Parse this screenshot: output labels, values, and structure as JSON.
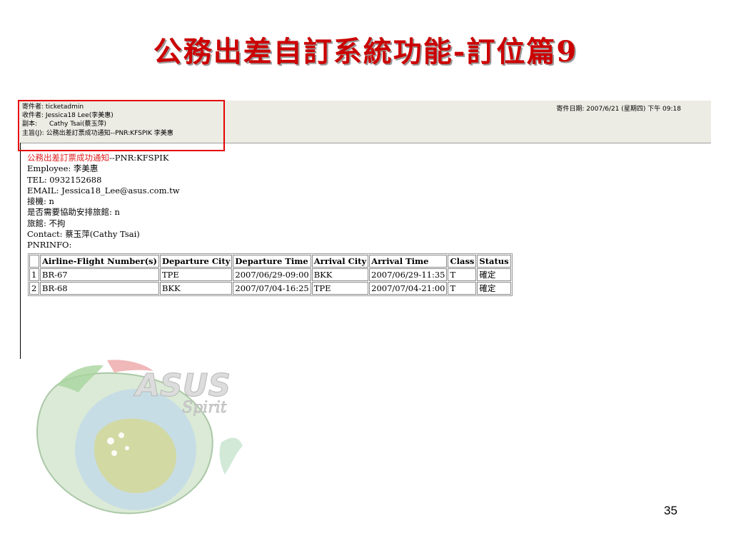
{
  "slide": {
    "title": "公務出差自訂系統功能-訂位篇9",
    "page_number": "35",
    "logo_text_1": "ASUS",
    "logo_text_2": "Spirit"
  },
  "mail": {
    "header": {
      "from_label": "寄件者:",
      "from_value": "ticketadmin",
      "to_label": "收件者:",
      "to_value": "Jessica18 Lee(李美惠)",
      "cc_label": "副本:",
      "cc_value": "Cathy Tsai(蔡玉萍)",
      "subject_label": "主旨(J):",
      "subject_value": "公務出差訂票成功通知--PNR:KFSPIK 李美惠",
      "date_label": "寄件日期:",
      "date_value": "2007/6/21 (星期四) 下午 09:18"
    },
    "body": {
      "line1_red": "公務出差訂票成功通知",
      "line1_rest": "--PNR:KFSPIK",
      "line2": "Employee: 李美惠",
      "line3": "TEL: 0932152688",
      "line4": "EMAIL: Jessica18_Lee@asus.com.tw",
      "line5": "接機: n",
      "line6": "是否需要協助安排旅館: n",
      "line7": "旅館: 不拘",
      "line8": "Contact: 蔡玉萍(Cathy Tsai)",
      "line9": "PNRINFO:"
    },
    "table": {
      "headers": [
        "",
        "Airline-Flight Number(s)",
        "Departure City",
        "Departure Time",
        "Arrival City",
        "Arrival Time",
        "Class",
        "Status"
      ],
      "rows": [
        [
          "1",
          "BR-67",
          "TPE",
          "2007/06/29-09:00",
          "BKK",
          "2007/06/29-11:35",
          "T",
          "確定"
        ],
        [
          "2",
          "BR-68",
          "BKK",
          "2007/07/04-16:25",
          "TPE",
          "2007/07/04-21:00",
          "T",
          "確定"
        ]
      ]
    }
  },
  "colors": {
    "title_red": "#cc0000",
    "highlight_box": "#e60000",
    "header_bg": "#ecebe4"
  }
}
